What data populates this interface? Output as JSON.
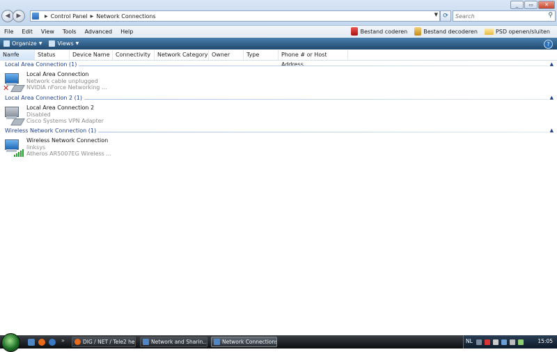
{
  "window": {
    "controls": [
      "_",
      "▭",
      "✕"
    ]
  },
  "address": {
    "breadcrumbs": [
      "Control Panel",
      "Network Connections"
    ],
    "search_placeholder": "Search"
  },
  "menu": {
    "items": [
      "File",
      "Edit",
      "View",
      "Tools",
      "Advanced",
      "Help"
    ],
    "right": [
      "Bestand coderen",
      "Bestand decoderen",
      "PSD openen/sluiten"
    ]
  },
  "toolbar": {
    "organize": "Organize",
    "views": "Views"
  },
  "columns": [
    "Name",
    "Status",
    "Device Name",
    "Connectivity",
    "Network Category",
    "Owner",
    "Type",
    "Phone # or Host Address"
  ],
  "groups": [
    {
      "title": "Local Area Connection (1)",
      "item": {
        "name": "Local Area Connection",
        "status": "Network cable unplugged",
        "device": "NVIDIA nForce Networking ...",
        "icon": "wired-disconnected-icon"
      }
    },
    {
      "title": "Local Area Connection 2 (1)",
      "item": {
        "name": "Local Area Connection 2",
        "status": "Disabled",
        "device": "Cisco Systems VPN Adapter",
        "icon": "wired-disabled-icon"
      }
    },
    {
      "title": "Wireless Network Connection (1)",
      "item": {
        "name": "Wireless Network Connection",
        "status": "linksys",
        "device": "Atheros AR5007EG Wireless ...",
        "icon": "wireless-connected-icon"
      }
    }
  ],
  "taskbar": {
    "tasks": [
      {
        "label": "DIG / NET / Tele2 he..."
      },
      {
        "label": "Network and Sharin..."
      },
      {
        "label": "Network Connections"
      }
    ],
    "language": "NL",
    "clock": "15:05"
  },
  "colors": {
    "toolbar": "#2d5d8a",
    "group_title": "#1e3f8a",
    "error_x": "#d4170c",
    "signal": "#21a12c"
  }
}
